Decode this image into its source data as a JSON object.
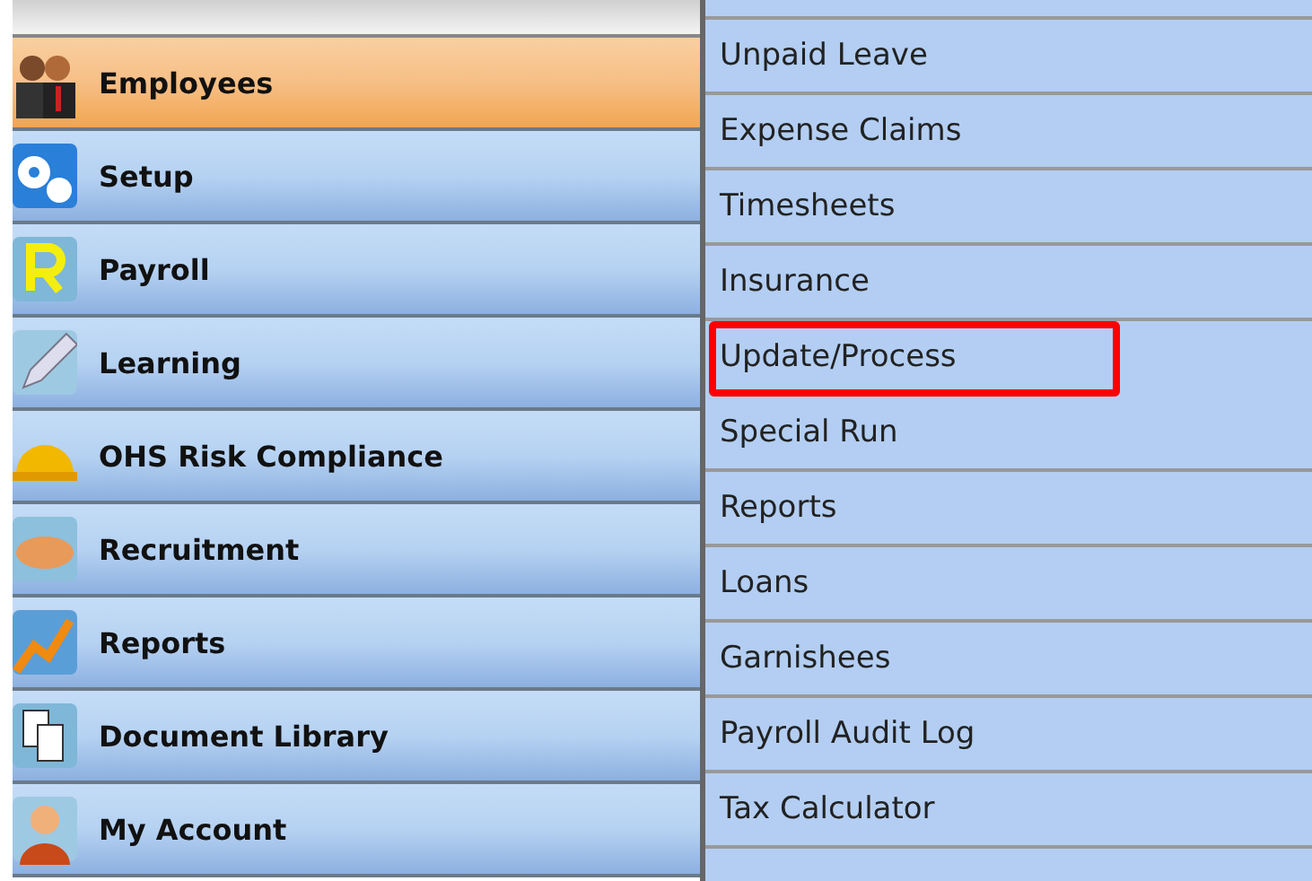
{
  "main_menu": [
    {
      "label": "Employees",
      "selected": true
    },
    {
      "label": "Setup",
      "selected": false
    },
    {
      "label": "Payroll",
      "selected": false
    },
    {
      "label": "Learning",
      "selected": false
    },
    {
      "label": "OHS Risk Compliance",
      "selected": false
    },
    {
      "label": "Recruitment",
      "selected": false
    },
    {
      "label": "Reports",
      "selected": false
    },
    {
      "label": "Document Library",
      "selected": false
    },
    {
      "label": "My Account",
      "selected": false
    }
  ],
  "submenu": [
    {
      "label": "Unpaid Leave",
      "highlighted": false
    },
    {
      "label": "Expense Claims",
      "highlighted": false
    },
    {
      "label": "Timesheets",
      "highlighted": false
    },
    {
      "label": "Insurance",
      "highlighted": false
    },
    {
      "label": "Update/Process",
      "highlighted": true
    },
    {
      "label": "Special Run",
      "highlighted": false
    },
    {
      "label": "Reports",
      "highlighted": false
    },
    {
      "label": "Loans",
      "highlighted": false
    },
    {
      "label": "Garnishees",
      "highlighted": false
    },
    {
      "label": "Payroll Audit Log",
      "highlighted": false
    },
    {
      "label": "Tax Calculator",
      "highlighted": false
    }
  ]
}
